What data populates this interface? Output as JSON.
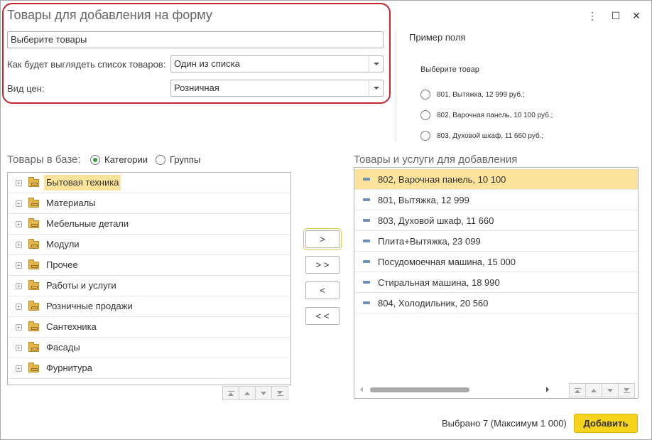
{
  "window": {
    "title": "Товары для добавления на форму",
    "controls": {
      "more": "⋮",
      "maximize": "☐",
      "close": "✕"
    }
  },
  "settings": {
    "header_value": "Выберите товары",
    "list_view_label": "Как будет выглядеть список товаров:",
    "list_view_value": "Один из списка",
    "price_type_label": "Вид цен:",
    "price_type_value": "Розничная"
  },
  "sample": {
    "title": "Пример поля",
    "heading": "Выберите товар",
    "options": [
      "801, Вытяжка, 12 999 руб.;",
      "802, Варочная панель, 10 100 руб.;",
      "803, Духовой шкаф, 11 660 руб.;"
    ]
  },
  "catalog": {
    "title": "Товары в базе:",
    "view_options": [
      {
        "label": "Категории",
        "selected": true
      },
      {
        "label": "Группы",
        "selected": false
      }
    ],
    "items": [
      "Бытовая техника",
      "Материалы",
      "Мебельные детали",
      "Модули",
      "Прочее",
      "Работы и услуги",
      "Розничные продажи",
      "Сантехника",
      "Фасады",
      "Фурнитура"
    ],
    "selected_index": 0
  },
  "transfer_buttons": {
    "add_one": ">",
    "add_all": "> >",
    "remove_one": "<",
    "remove_all": "< <"
  },
  "selection": {
    "title": "Товары и услуги для добавления",
    "items": [
      "802, Варочная панель, 10 100",
      "801, Вытяжка, 12 999",
      "803, Духовой шкаф, 11 660",
      "Плита+Вытяжка, 23 099",
      "Посудомоечная машина, 15 000",
      "Стиральная машина, 18 990",
      "804, Холодильник, 20 560"
    ],
    "active_index": 0
  },
  "footer": {
    "status": "Выбрано 7 (Максимум 1 000)",
    "add_label": "Добавить"
  },
  "colors": {
    "accent": "#f6d31c",
    "highlight_box": "#c1272d",
    "selection_bg": "#fce39c",
    "radio_on": "#3a9a3a"
  },
  "icons": {
    "tree_expand": "plus-icon",
    "tree_node": "folder-icon",
    "list_item": "dash-icon"
  }
}
